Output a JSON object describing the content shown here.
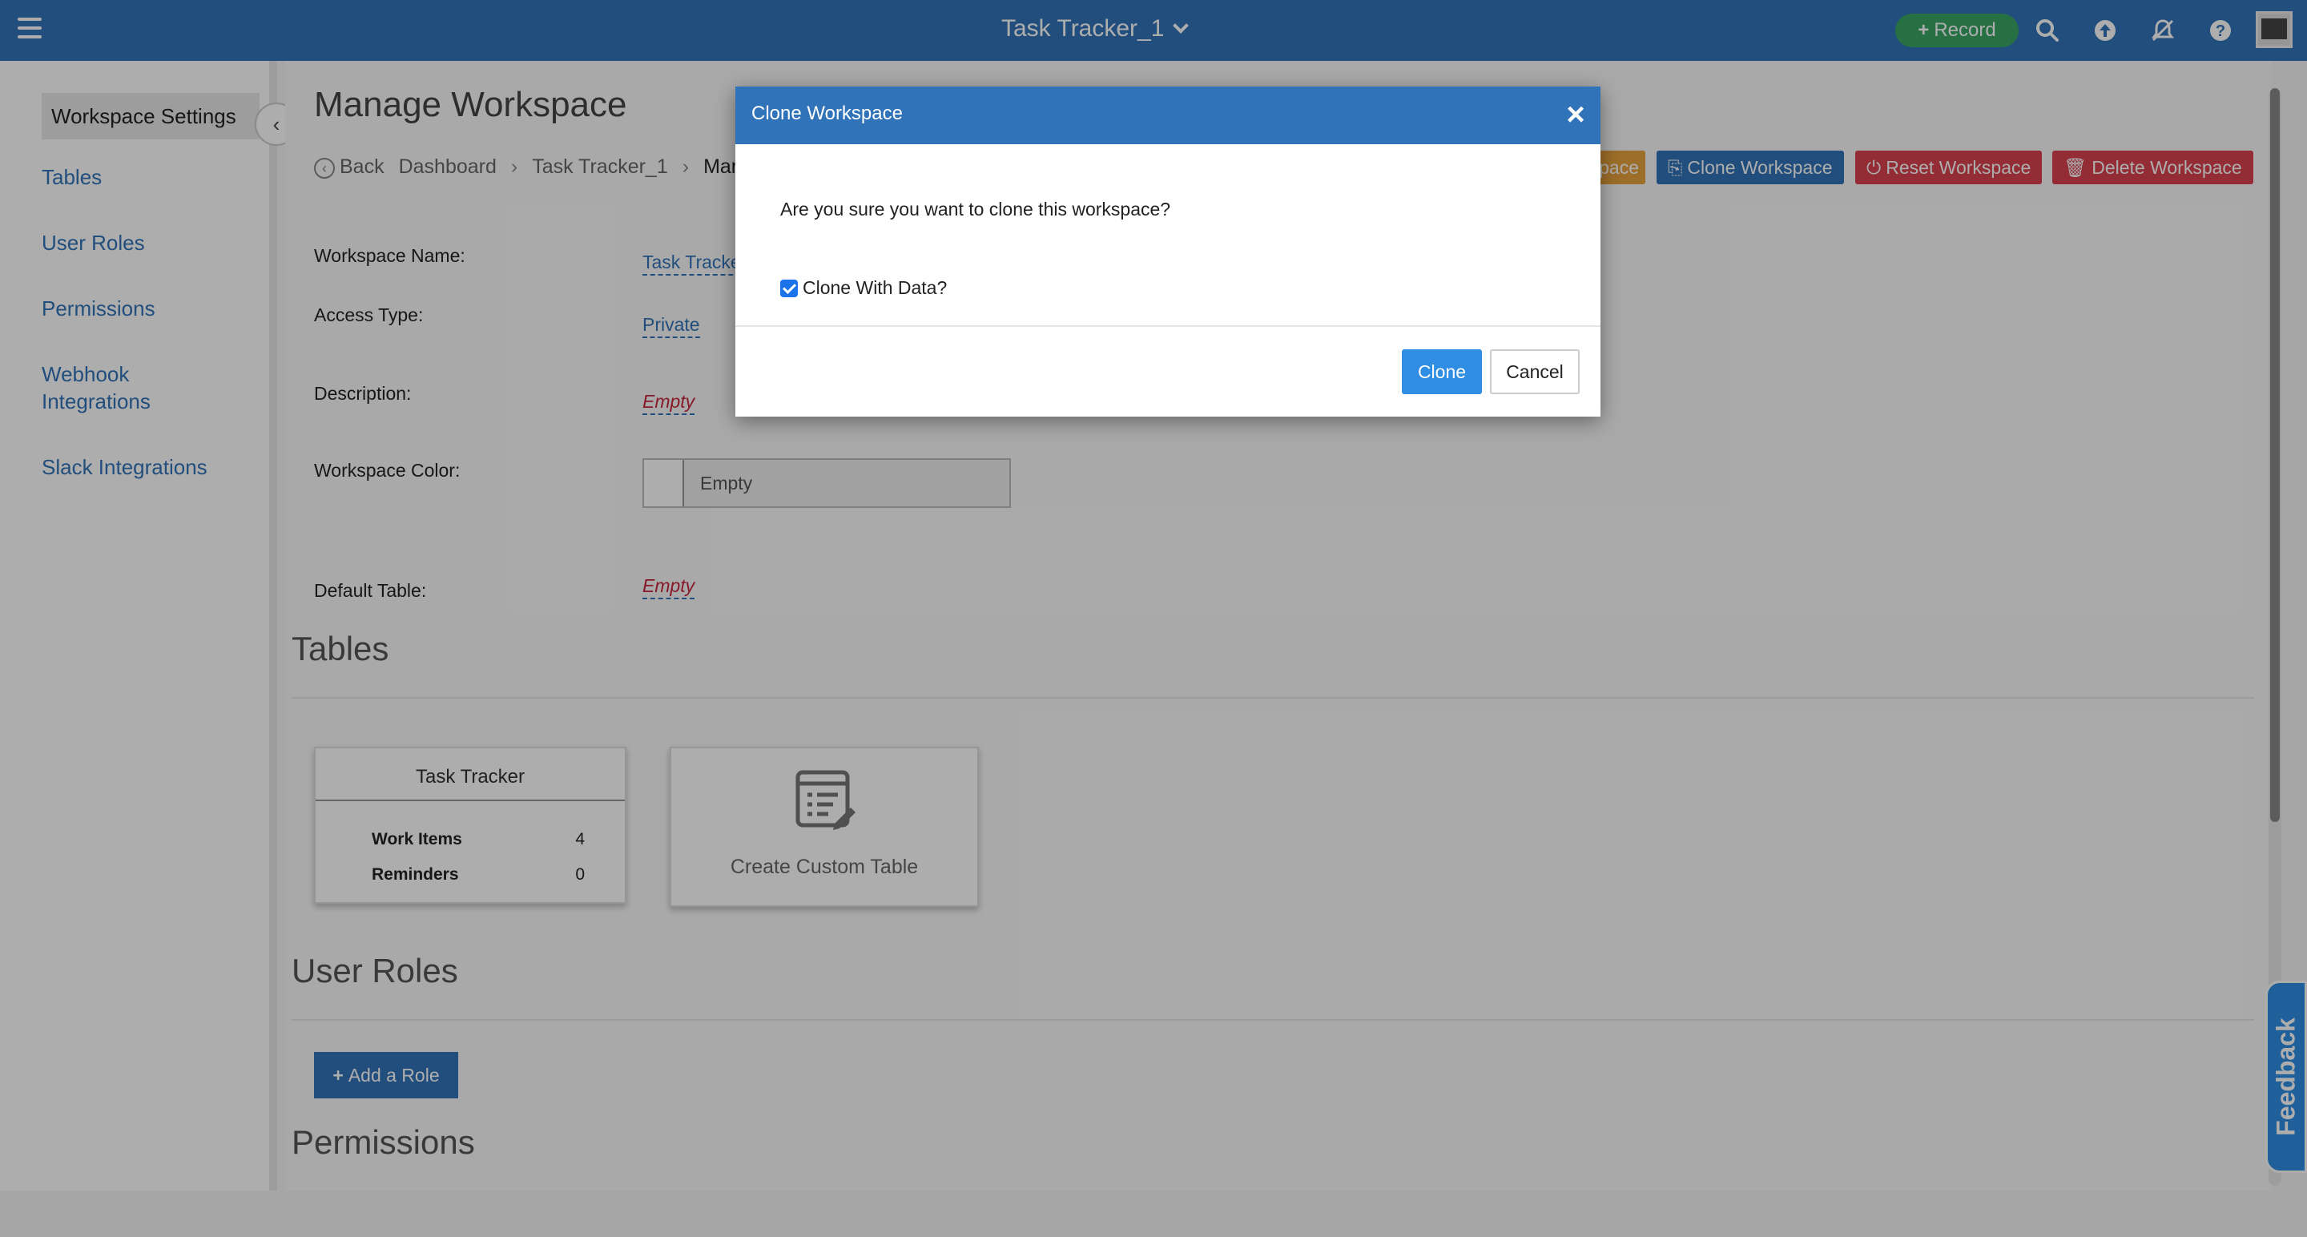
{
  "topbar": {
    "menu_icon": "hamburger-icon",
    "app_title": "Task Tracker_1",
    "record_label": "Record",
    "icons": [
      "search-icon",
      "upload-icon",
      "notifications-off-icon",
      "help-icon"
    ],
    "brand_color": "#3173b8",
    "record_color": "#3aa665"
  },
  "sidebar": {
    "items": [
      {
        "label": "Workspace Settings",
        "active": true
      },
      {
        "label": "Tables"
      },
      {
        "label": "User Roles"
      },
      {
        "label": "Permissions"
      },
      {
        "label": "Webhook Integrations"
      },
      {
        "label": "Slack Integrations"
      }
    ],
    "collapse_label": "‹"
  },
  "header": {
    "title": "Manage Workspace",
    "buttons": {
      "partial_label": "pace",
      "clone": "Clone Workspace",
      "reset": "Reset Workspace",
      "delete": "Delete Workspace"
    }
  },
  "breadcrumb": {
    "back": "Back",
    "items": [
      "Dashboard",
      "Task Tracker_1",
      "Mar"
    ]
  },
  "fields": {
    "workspace_name": {
      "label": "Workspace Name:",
      "value": "Task Tracke"
    },
    "access_type": {
      "label": "Access Type:",
      "value": "Private"
    },
    "description": {
      "label": "Description:",
      "value": "Empty"
    },
    "workspace_color": {
      "label": "Workspace Color:",
      "value": "Empty"
    },
    "default_table": {
      "label": "Default Table:",
      "value": "Empty"
    }
  },
  "sections": {
    "tables": "Tables",
    "user_roles": "User Roles",
    "permissions": "Permissions"
  },
  "tables": {
    "card": {
      "title": "Task Tracker",
      "rows": [
        {
          "label": "Work Items",
          "count": "4"
        },
        {
          "label": "Reminders",
          "count": "0"
        }
      ]
    },
    "create_label": "Create Custom Table"
  },
  "user_roles": {
    "add_label": "Add a Role"
  },
  "feedback": {
    "label": "Feedback"
  },
  "modal": {
    "title": "Clone Workspace",
    "close": "×",
    "question": "Are you sure you want to clone this workspace?",
    "checkbox_label": "Clone With Data?",
    "checkbox_checked": true,
    "confirm": "Clone",
    "cancel": "Cancel"
  }
}
